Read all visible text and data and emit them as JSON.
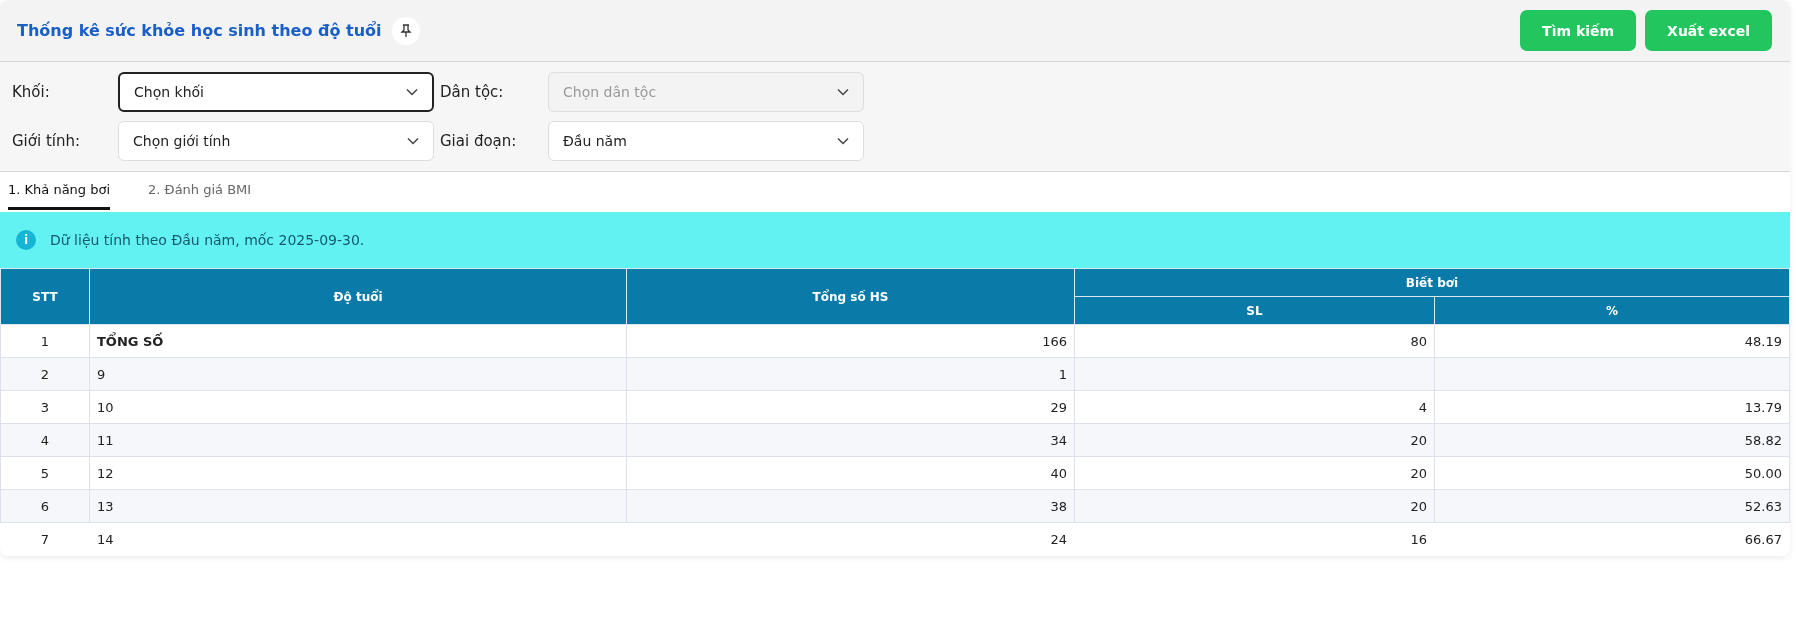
{
  "header": {
    "title": "Thống kê sức khỏe học sinh theo độ tuổi",
    "buttons": [
      "Tìm kiếm",
      "Xuất excel"
    ]
  },
  "filters": [
    {
      "label": "Khối:",
      "value": "Chọn khối",
      "focused": true,
      "disabled": false
    },
    {
      "label": "Dân tộc:",
      "placeholder": "Chọn dân tộc",
      "focused": false,
      "disabled": true
    },
    {
      "label": "Giới tính:",
      "value": "Chọn giới tính",
      "focused": false,
      "disabled": false
    },
    {
      "label": "Giai đoạn:",
      "value": "Đầu năm",
      "focused": false,
      "disabled": false
    }
  ],
  "tabs": [
    {
      "label": "1. Khả năng bơi",
      "selected": true
    },
    {
      "label": "2. Đánh giá BMI",
      "selected": false
    }
  ],
  "info": {
    "icon": "i",
    "text": "Dữ liệu tính theo Đầu năm, mốc 2025-09-30."
  },
  "table": {
    "columns": {
      "stt": "STT",
      "age": "Độ tuổi",
      "total": "Tổng số HS",
      "group": "Biết bơi",
      "sl": "SL",
      "pct": "%"
    },
    "rows": [
      {
        "stt": "1",
        "age": "TỔNG SỐ",
        "total": "166",
        "sl": "80",
        "pct": "48.19",
        "bold": true,
        "hovered": false
      },
      {
        "stt": "2",
        "age": "9",
        "total": "1",
        "sl": "",
        "pct": "",
        "bold": false,
        "hovered": false
      },
      {
        "stt": "3",
        "age": "10",
        "total": "29",
        "sl": "4",
        "pct": "13.79",
        "bold": false,
        "hovered": false
      },
      {
        "stt": "4",
        "age": "11",
        "total": "34",
        "sl": "20",
        "pct": "58.82",
        "bold": false,
        "hovered": false
      },
      {
        "stt": "5",
        "age": "12",
        "total": "40",
        "sl": "20",
        "pct": "50.00",
        "bold": false,
        "hovered": false
      },
      {
        "stt": "6",
        "age": "13",
        "total": "38",
        "sl": "20",
        "pct": "52.63",
        "bold": false,
        "hovered": false
      },
      {
        "stt": "7",
        "age": "14",
        "total": "24",
        "sl": "16",
        "pct": "66.67",
        "bold": false,
        "hovered": true
      }
    ]
  }
}
